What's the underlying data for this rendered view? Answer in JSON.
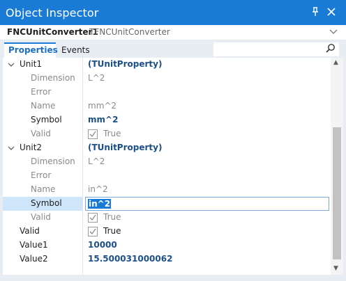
{
  "window": {
    "title": "Object Inspector",
    "pin_icon": "pin-icon",
    "close_icon": "close-icon"
  },
  "object_selector": {
    "name": "FNCUnitConverter1",
    "type": "TFNCUnitConverter"
  },
  "tabs": [
    {
      "label": "Properties",
      "active": true
    },
    {
      "label": "Events",
      "active": false
    }
  ],
  "search": {
    "icon": "search-icon",
    "value": ""
  },
  "properties": [
    {
      "name": "Unit1",
      "value": "(TUnitProperty)",
      "expanded": true
    },
    {
      "name": "Dimension",
      "value": "L^2"
    },
    {
      "name": "Error",
      "value": ""
    },
    {
      "name": "Name",
      "value": "mm^2"
    },
    {
      "name": "Symbol",
      "value": "mm^2"
    },
    {
      "name": "Valid",
      "value": "True",
      "checked": true
    },
    {
      "name": "Unit2",
      "value": "(TUnitProperty)",
      "expanded": true
    },
    {
      "name": "Dimension",
      "value": "L^2"
    },
    {
      "name": "Error",
      "value": ""
    },
    {
      "name": "Name",
      "value": "in^2"
    },
    {
      "name": "Symbol",
      "value": "in^2",
      "selected": true
    },
    {
      "name": "Valid",
      "value": "True",
      "checked": true
    },
    {
      "name": "Valid",
      "value": "True",
      "checked": true
    },
    {
      "name": "Value1",
      "value": "10000"
    },
    {
      "name": "Value2",
      "value": "15.500031000062"
    }
  ],
  "colors": {
    "titlebar": "#1a7bd6",
    "selection": "#cfe5fa",
    "value_bold": "#1c4f8a"
  }
}
